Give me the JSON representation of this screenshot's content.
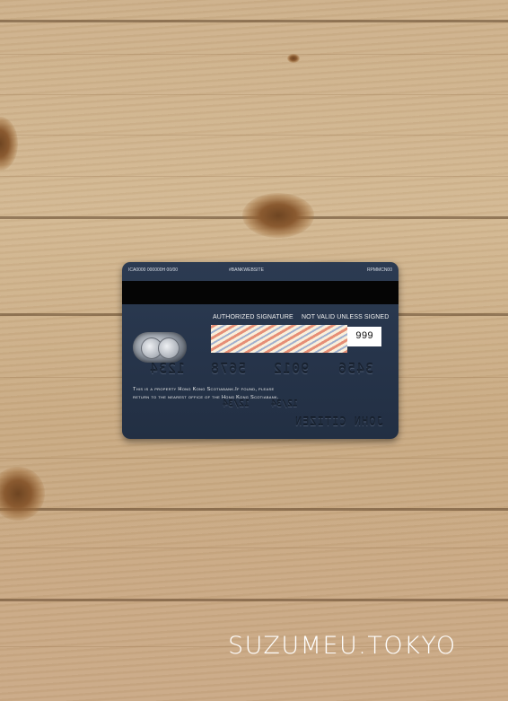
{
  "card": {
    "top_left_code": "ICA0000 000000H 00/00",
    "top_center": "#BANKWEBSITE",
    "top_right": "RPMMCN00",
    "authorized_signature": "AUTHORIZED SIGNATURE",
    "not_valid": "NOT VALID UNLESS SIGNED",
    "cvv": "999",
    "card_number_groups": [
      "1234",
      "5678",
      "9012",
      "3456"
    ],
    "expiry_groups": [
      "12/34",
      "12/34"
    ],
    "cardholder_name": "JOHN CITIZEN",
    "property_line_1": "This is a property Hong Kong Scotiabank.If found, please",
    "property_line_2": "return to the nearest office of the Hong Kong Scotiabank."
  },
  "watermark": "SUZUMEU.TOKYO",
  "colors": {
    "card_navy": "#26344a",
    "magnetic_stripe": "#050505",
    "wood": "#cdb08a"
  },
  "icons": {
    "hologram": "globe-hologram-icon"
  }
}
